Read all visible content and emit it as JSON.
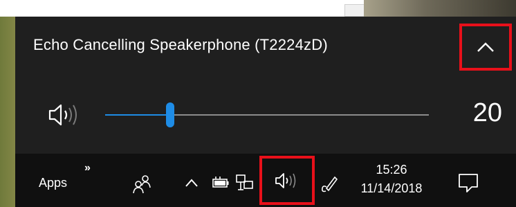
{
  "volume_flyout": {
    "device_name": "Echo Cancelling Speakerphone (T2224zD)",
    "expand_icon": "chevron-up-icon",
    "speaker_icon": "speaker-volume-icon",
    "volume_value": "20",
    "volume_level": 0.2,
    "accent_color": "#1e8ce6",
    "highlight_color": "#e8101a"
  },
  "taskbar": {
    "apps_label": "Apps",
    "overflow_chevrons": "»",
    "icons": [
      "people-icon",
      "show-hidden-icons-caret",
      "battery-icon",
      "network-icon",
      "volume-icon",
      "pen-workspace-icon",
      "action-center-icon"
    ],
    "time": "15:26",
    "date": "11/14/2018"
  }
}
